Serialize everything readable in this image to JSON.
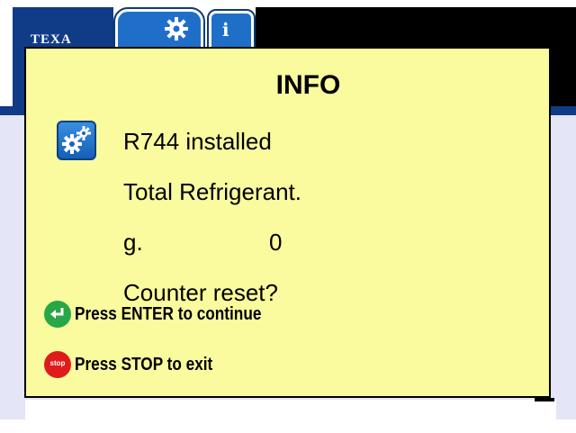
{
  "header": {
    "logo_text": "TEXA",
    "tabs": [
      {
        "icon": "gear-icon",
        "active": true
      },
      {
        "icon": "info-icon",
        "active": false
      }
    ]
  },
  "dialog": {
    "title": "INFO",
    "icon": "gear-icon",
    "lines": {
      "status": "R744 installed",
      "total_label": "Total Refrigerant.",
      "unit": "g.",
      "amount": "0",
      "question": "Counter reset?"
    },
    "actions": {
      "enter": {
        "badge_icon": "enter-arrow-icon",
        "label": "Press ENTER to continue"
      },
      "stop": {
        "badge_text": "stop",
        "label": "Press STOP to exit"
      }
    }
  },
  "colors": {
    "dialog_bg": "#fafa9e",
    "brand_blue": "#103b86",
    "accent_blue": "#1f6fc8",
    "enter_green": "#27a745",
    "stop_red": "#e01b1b",
    "screen_bg": "#e4e5f7"
  }
}
